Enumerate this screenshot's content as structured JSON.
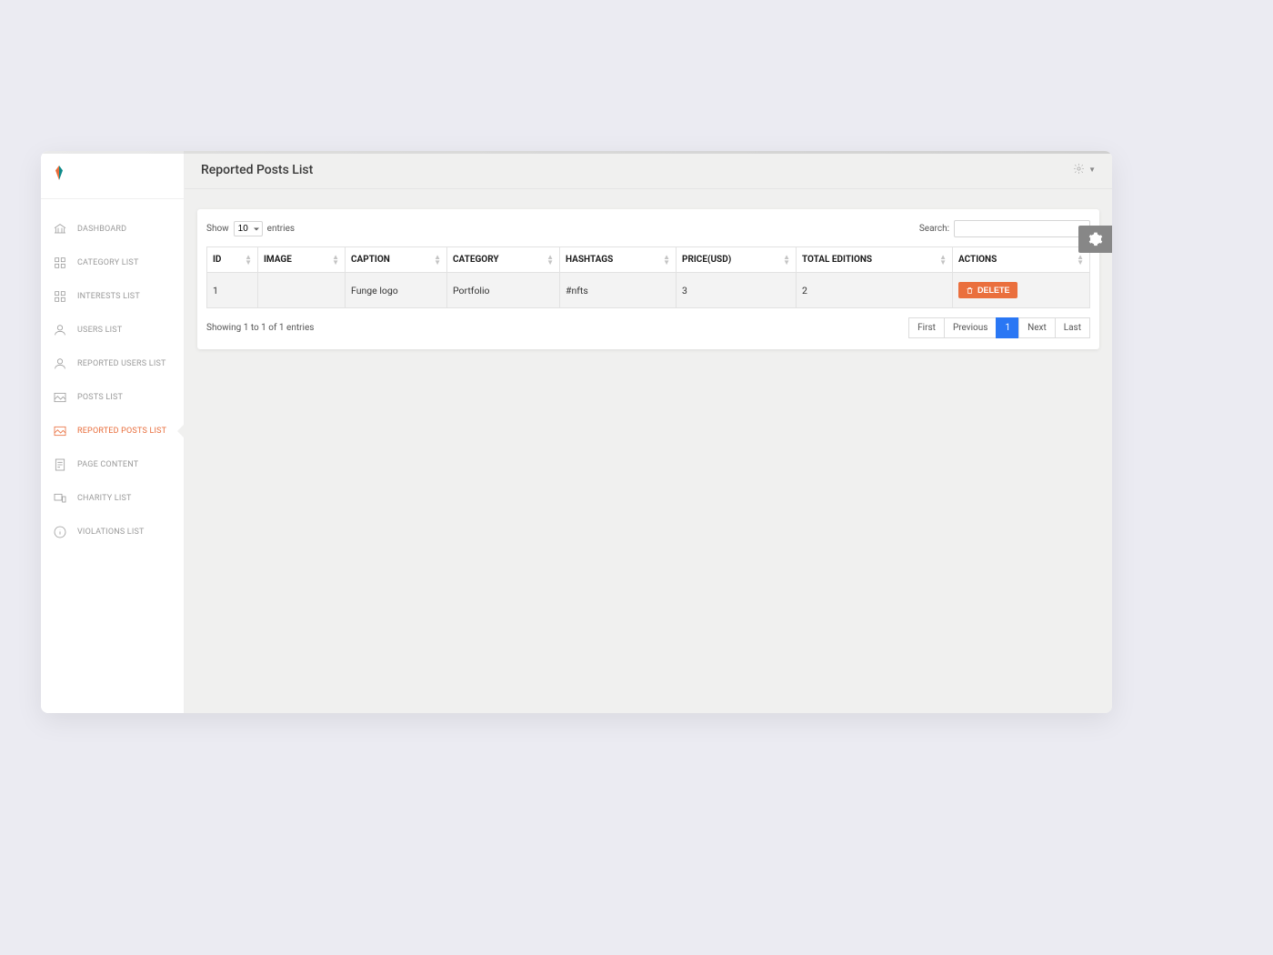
{
  "sidebar": {
    "items": [
      {
        "label": "DASHBOARD",
        "icon": "bank"
      },
      {
        "label": "CATEGORY LIST",
        "icon": "grid"
      },
      {
        "label": "INTERESTS LIST",
        "icon": "grid"
      },
      {
        "label": "USERS LIST",
        "icon": "user"
      },
      {
        "label": "REPORTED USERS LIST",
        "icon": "user"
      },
      {
        "label": "POSTS LIST",
        "icon": "image"
      },
      {
        "label": "REPORTED POSTS LIST",
        "icon": "image",
        "active": true
      },
      {
        "label": "PAGE CONTENT",
        "icon": "doc"
      },
      {
        "label": "CHARITY LIST",
        "icon": "devices"
      },
      {
        "label": "VIOLATIONS LIST",
        "icon": "info"
      }
    ]
  },
  "header": {
    "title": "Reported Posts List"
  },
  "toolbar": {
    "show_label": "Show",
    "entries_label": "entries",
    "entries_value": "10",
    "search_label": "Search:",
    "search_value": ""
  },
  "table": {
    "columns": [
      "ID",
      "IMAGE",
      "CAPTION",
      "CATEGORY",
      "HASHTAGS",
      "PRICE(USD)",
      "TOTAL EDITIONS",
      "ACTIONS"
    ],
    "rows": [
      {
        "id": "1",
        "image": "",
        "caption": "Funge logo",
        "category": "Portfolio",
        "hashtags": "#nfts",
        "price": "3",
        "editions": "2"
      }
    ],
    "delete_label": "DELETE"
  },
  "footer": {
    "info": "Showing 1 to 1 of 1 entries",
    "pager": {
      "first": "First",
      "previous": "Previous",
      "page": "1",
      "next": "Next",
      "last": "Last"
    }
  }
}
